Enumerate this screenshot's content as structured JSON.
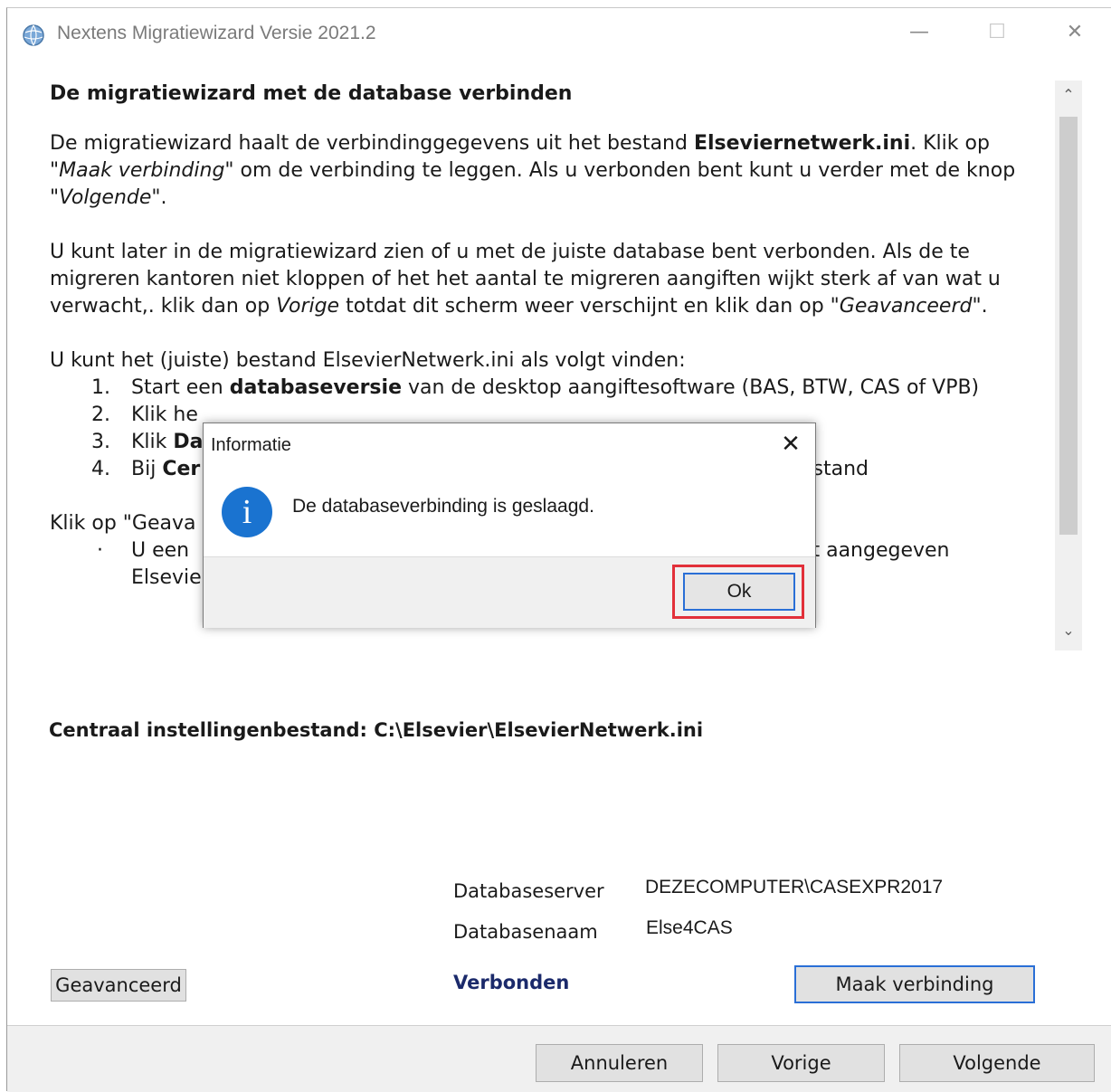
{
  "window": {
    "title": "Nextens Migratiewizard Versie 2021.2",
    "minimize": "—",
    "maximize": "☐",
    "close": "✕"
  },
  "content": {
    "heading": "De migratiewizard met de database verbinden",
    "p1": {
      "a": "De migratiewizard haalt de verbinding­gegevens uit het bestand ",
      "b": "Elseviernetwerk.ini",
      "c": ". Klik op ",
      "d": "\"Maak verbinding\"",
      "e": " om de verbinding te leggen. Als u verbonden bent kunt u verder met de knop ",
      "f": "\"Volgende\"",
      "g": "."
    },
    "p2": {
      "a": "U kunt later in de migratiewizard zien of u met de juiste database bent verbonden. Als de te migreren kantoren niet kloppen of het het aantal te migreren aangiften wijkt sterk af van wat u verwacht,. klik dan op ",
      "b": "Vorige",
      "c": " totdat dit scherm weer verschijnt en klik dan op ",
      "d": "\"Geavanceerd\"",
      "e": "."
    },
    "p3_intro": "U kunt het (juiste) bestand ElsevierNetwerk.ini als volgt vinden:",
    "steps": [
      {
        "num": "1.",
        "a": "Start een ",
        "b": "databaseversie",
        "c": " van de desktop aangiftesoftware (BAS, BTW, CAS of VPB)"
      },
      {
        "num": "2.",
        "a": "Klik he",
        "b": "",
        "c": ""
      },
      {
        "num": "3.",
        "a": "Klik ",
        "b": "Da",
        "c": ""
      },
      {
        "num": "4.",
        "a": "Bij ",
        "b": "Cer",
        "c": "bestand"
      }
    ],
    "p4_intro": "Klik op \"Geava",
    "bullet": {
      "mark": "·",
      "line1": "U een",
      "line1_end": "het aangegeven",
      "line2": "ElsevierNetwerk.ini wilt gebruiken."
    }
  },
  "scroll": {
    "up": "⌃",
    "down": "⌄"
  },
  "central": "Centraal instellingenbestand: C:\\Elsevier\\ElsevierNetwerk.ini",
  "db": {
    "server_label": "Databaseserver",
    "server_value": "DEZECOMPUTER\\CASEXPR2017",
    "name_label": "Databasenaam",
    "name_value": "Else4CAS"
  },
  "buttons": {
    "advanced": "Geavanceerd",
    "connect": "Maak verbinding",
    "cancel": "Annuleren",
    "previous": "Vorige",
    "next": "Volgende"
  },
  "status": "Verbonden",
  "dialog": {
    "title": "Informatie",
    "close": "✕",
    "icon": "i",
    "message": "De databaseverbinding is geslaagd.",
    "ok": "Ok"
  },
  "colors": {
    "accent": "#2a6fd6",
    "highlight": "#e2303a",
    "info": "#1a73d0",
    "status": "#1b2a6b"
  }
}
